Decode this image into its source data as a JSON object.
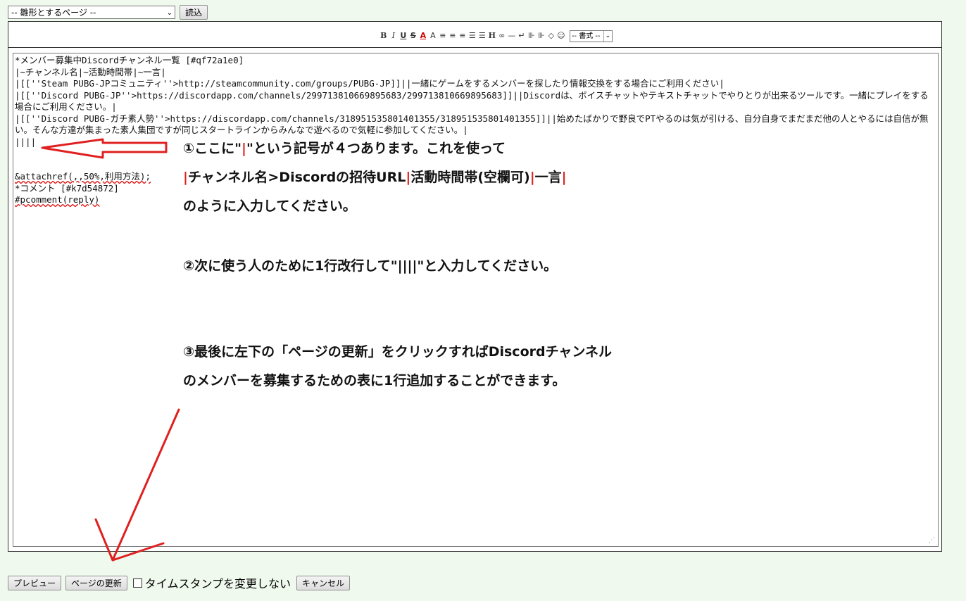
{
  "template_select": {
    "value": "-- 雛形とするページ --"
  },
  "load_button": "読込",
  "toolbar": {
    "tools": [
      "B",
      "I",
      "U",
      "S",
      "A",
      "A",
      "≡",
      "≡",
      "≡",
      "☰",
      "☰",
      "H",
      "∞",
      "—",
      "↵",
      "⊪",
      "⊪",
      "◇",
      "☺"
    ],
    "format_select": "-- 書式 --"
  },
  "editor": {
    "lines": [
      "*メンバー募集中Discordチャンネル一覧 [#qf72a1e0]",
      "|~チャンネル名|~活動時間帯|~一言|",
      "|[[''Steam PUBG-JPコミュニティ''>http://steamcommunity.com/groups/PUBG-JP]]||一緒にゲームをするメンバーを探したり情報交換をする場合にご利用ください|",
      "|[[''Discord PUBG-JP''>https://discordapp.com/channels/299713810669895683/299713810669895683]]||Discordは、ボイスチャットやテキストチャットでやりとりが出来るツールです。一緒にプレイをする場合にご利用ください。|",
      "|[[''Discord PUBG-ガチ素人勢''>https://discordapp.com/channels/318951535801401355/318951535801401355]]||始めたばかりで野良でPTやるのは気が引ける、自分自身でまだまだ他の人とやるには自信が無い。そんな方達が集まった素人集団ですが同じスタートラインからみんなで遊べるので気軽に参加してください。|",
      "||||",
      "",
      "",
      "&attachref(,,50%,利用方法);",
      "*コメント [#k7d54872]",
      "#pcomment(reply)"
    ]
  },
  "annotations": {
    "step1_a": "①ここに\"",
    "step1_pipe": "|",
    "step1_b": "\"という記号が４つあります。これを使って",
    "step1_line2": [
      "|",
      "チャンネル名>Discordの招待URL",
      "|",
      "活動時間帯(空欄可)",
      "|",
      "一言",
      "|"
    ],
    "step1_line3": "のように入力してください。",
    "step2": "②次に使う人のために1行改行して\"||||\"と入力してください。",
    "step3_line1": "③最後に左下の「ページの更新」をクリックすればDiscordチャンネル",
    "step3_line2": "のメンバーを募集するための表に1行追加することができます。"
  },
  "bottom": {
    "preview_button": "プレビュー",
    "update_button": "ページの更新",
    "timestamp_label": "タイムスタンプを変更しない",
    "cancel_button": "キャンセル"
  },
  "colors": {
    "accent_red": "#e02020",
    "page_bg": "#f0f9ee"
  }
}
